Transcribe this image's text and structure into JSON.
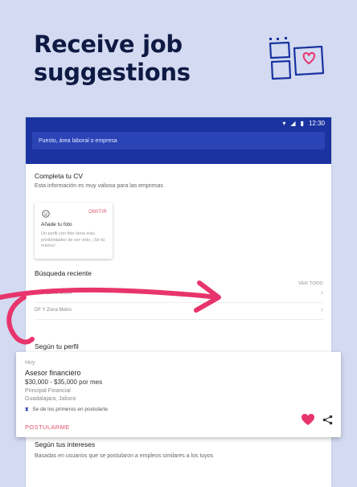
{
  "headline": {
    "line1": "Receive job",
    "line2": "suggestions"
  },
  "status_bar": {
    "time": "12:30"
  },
  "search": {
    "placeholder": "Puesto, área laboral o empresa"
  },
  "cv_section": {
    "title": "Completa tu CV",
    "subtitle": "Esta información es muy valiosa para las empresas",
    "card": {
      "omit_label": "OMITIR",
      "label": "Añade tu foto",
      "text": "Un perfil con foto tiene más posibilidades de ser visto, ¡Sé tú mismo!"
    }
  },
  "recent_search": {
    "title": "Búsqueda reciente",
    "see_all": "VER TODO",
    "items": [
      "DF Y Zona Metro",
      "DF Y Zona Metro"
    ]
  },
  "profile_section": {
    "title": "Según tu perfil"
  },
  "job_card": {
    "date": "Hoy",
    "title": "Asesor financiero",
    "salary": "$30,000 - $35,000 por mes",
    "company": "Principal Financial",
    "location": "Guadalajara, Jalisco",
    "first_applicants": "Se de los primeros en postularte",
    "apply_label": "POSTULARME"
  },
  "interests_section": {
    "title": "Según tus intereses",
    "subtitle": "Basadas en usuarios que se postularon a empleos similares a los tuyos"
  },
  "colors": {
    "background": "#d3daf1",
    "brand_blue": "#1a33a0",
    "headline": "#0f1a44",
    "accent_pink": "#e0506c",
    "heart": "#e8346c"
  },
  "icons": {
    "doodle": "photo-frames-heart-doodle",
    "wifi": "wifi-icon",
    "signal": "signal-icon",
    "battery": "battery-icon",
    "face": "smiley-face-icon",
    "chevron": "chevron-right-icon",
    "first_badge": "hourglass-icon",
    "heart": "heart-icon",
    "share": "share-icon"
  }
}
